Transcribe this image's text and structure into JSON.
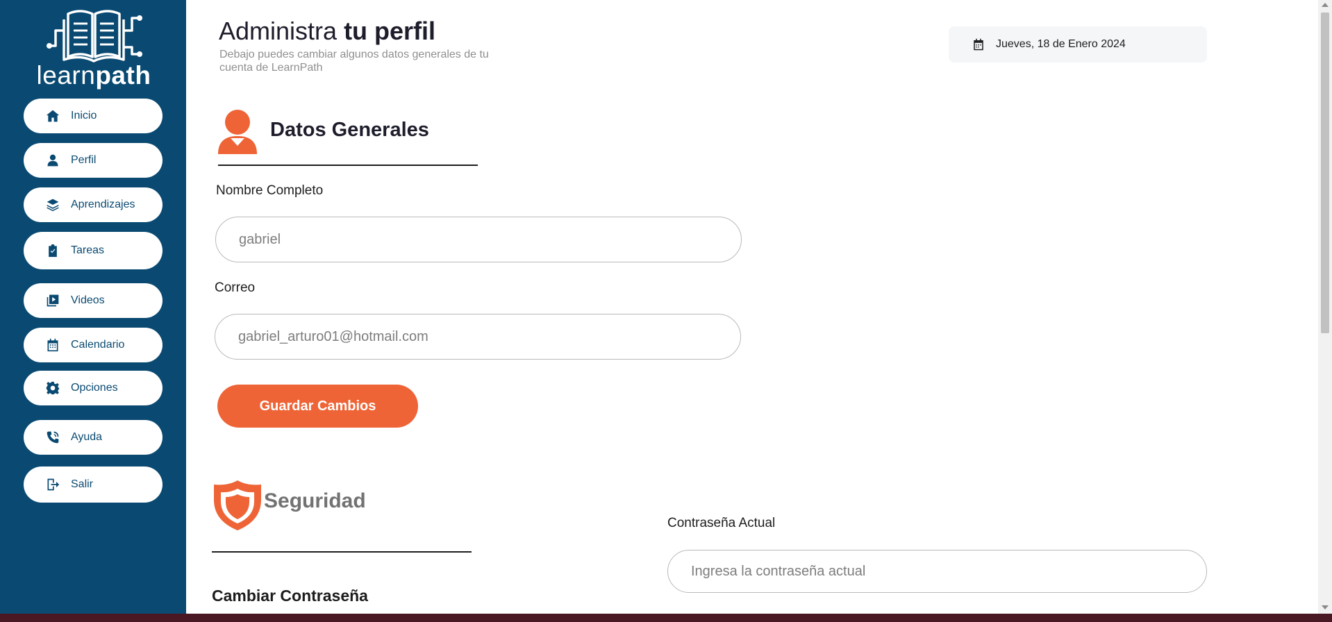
{
  "brand": {
    "name_light": "learn",
    "name_bold": "path"
  },
  "sidebar": {
    "items": [
      {
        "label": "Inicio",
        "icon": "home-icon"
      },
      {
        "label": "Perfil",
        "icon": "user-icon"
      },
      {
        "label": "Aprendizajes",
        "icon": "layers-icon"
      },
      {
        "label": "Tareas",
        "icon": "clipboard-check-icon"
      },
      {
        "label": "Videos",
        "icon": "video-icon"
      },
      {
        "label": "Calendario",
        "icon": "calendar-icon"
      },
      {
        "label": "Opciones",
        "icon": "gear-icon"
      },
      {
        "label": "Ayuda",
        "icon": "phone-icon"
      },
      {
        "label": "Salir",
        "icon": "logout-icon"
      }
    ]
  },
  "header": {
    "title_light": "Administra ",
    "title_bold": "tu perfil",
    "subtitle": "Debajo puedes cambiar algunos datos generales de tu cuenta de LearnPath",
    "date": "Jueves, 18 de Enero 2024"
  },
  "general": {
    "title": "Datos Generales",
    "name_label": "Nombre Completo",
    "name_value": "gabriel",
    "email_label": "Correo",
    "email_value": "gabriel_arturo01@hotmail.com",
    "save_label": "Guardar Cambios"
  },
  "security": {
    "title": "Seguridad",
    "change_password_title": "Cambiar Contraseña",
    "current_password_label": "Contraseña Actual",
    "current_password_placeholder": "Ingresa la contraseña actual"
  },
  "colors": {
    "sidebar": "#0a4a72",
    "accent": "#ee6436"
  }
}
